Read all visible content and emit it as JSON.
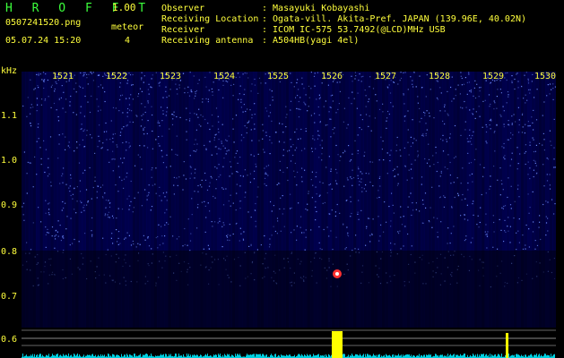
{
  "header": {
    "app_title": "H R O F F T",
    "app_version": "1.00",
    "file_name": "0507241520.png",
    "mode_label": "meteor",
    "date_time": "05.07.24 15:20",
    "meteor_count": "4",
    "info": [
      {
        "label": "Observer",
        "value": ": Masayuki Kobayashi"
      },
      {
        "label": "Receiving Location",
        "value": ": Ogata-vill. Akita-Pref. JAPAN (139.96E, 40.02N)"
      },
      {
        "label": "Receiver",
        "value": ": ICOM IC-575 53.7492(@LCD)MHz USB"
      },
      {
        "label": "Receiving antenna",
        "value": ": A504HB(yagi 4el)"
      }
    ]
  },
  "axes": {
    "y_unit": "kHz",
    "y_ticks": [
      "1.1",
      "1.0",
      "0.9",
      "0.8",
      "0.7",
      "0.6"
    ],
    "x_ticks": [
      "1521",
      "1522",
      "1523",
      "1524",
      "1525",
      "1526",
      "1527",
      "1528",
      "1529",
      "1530"
    ]
  },
  "colors": {
    "text_primary": "#ffff3c",
    "text_secondary": "#3cff3c",
    "background": "#000000",
    "spectrogram_low": "#00005a",
    "spectrogram_high": "#6e8cff",
    "signal_strip": "#00d0e0",
    "meteor_echo": "#ffff00"
  }
}
